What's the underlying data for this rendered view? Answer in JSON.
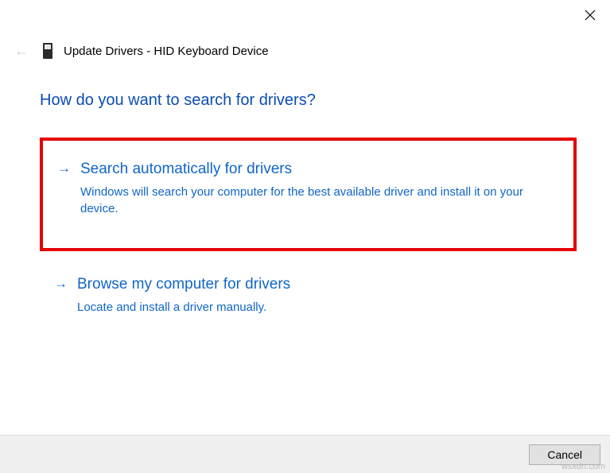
{
  "header": {
    "title": "Update Drivers - HID Keyboard Device"
  },
  "main": {
    "question": "How do you want to search for drivers?",
    "options": [
      {
        "title": "Search automatically for drivers",
        "description": "Windows will search your computer for the best available driver and install it on your device."
      },
      {
        "title": "Browse my computer for drivers",
        "description": "Locate and install a driver manually."
      }
    ]
  },
  "footer": {
    "cancel_label": "Cancel"
  },
  "watermark": "wsxdn.com"
}
